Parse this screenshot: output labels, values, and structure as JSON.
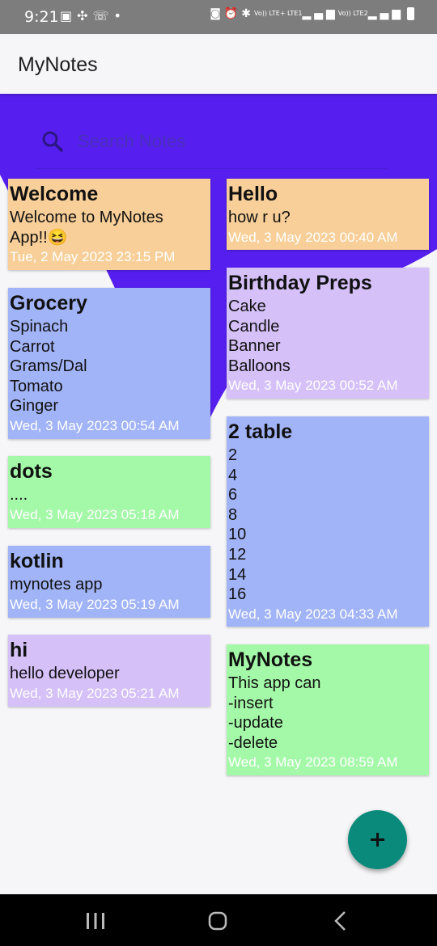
{
  "status_bar": {
    "time": "9:21",
    "left_icons": [
      "gallery-icon",
      "fan-icon",
      "missed-call-icon",
      "dot-icon"
    ],
    "right_icons": [
      "alarm-app-icon",
      "alarm-icon",
      "bluetooth-icon",
      "lte1-signal-icon",
      "lte2-signal-icon",
      "battery-icon"
    ],
    "lte1_label": "Vo)) LTE+\nLTE1",
    "lte2_label": "Vo))\nLTE2"
  },
  "app": {
    "title": "MyNotes"
  },
  "search": {
    "placeholder": "Search Notes",
    "value": ""
  },
  "colors": {
    "accent_purple": "#561ff0",
    "orange": "#f8cf98",
    "blue": "#a2b4f8",
    "green": "#a4f9a8",
    "lavender": "#d5c0f8",
    "fab": "#0a8a7a"
  },
  "notes": [
    {
      "title": "Welcome",
      "body": "Welcome to MyNotes\nApp!!😆",
      "date": "Tue, 2 May 2023 23:15 PM",
      "color": "#f8cf98"
    },
    {
      "title": "Hello",
      "body": "how r u?",
      "date": "Wed, 3 May 2023 00:40 AM",
      "color": "#f8cf98"
    },
    {
      "title": "Birthday Preps",
      "body": "Cake\nCandle\nBanner\nBalloons",
      "date": "Wed, 3 May 2023 00:52 AM",
      "color": "#d5c0f8"
    },
    {
      "title": "Grocery",
      "body": "Spinach\nCarrot\nGrams/Dal\nTomato\nGinger",
      "date": "Wed, 3 May 2023 00:54 AM",
      "color": "#a2b4f8"
    },
    {
      "title": "2 table",
      "body": "2\n4\n6\n8\n10\n12\n14\n16",
      "date": "Wed, 3 May 2023 04:33 AM",
      "color": "#a2b4f8"
    },
    {
      "title": "dots",
      "body": "....",
      "date": "Wed, 3 May 2023 05:18 AM",
      "color": "#a4f9a8"
    },
    {
      "title": "kotlin",
      "body": "mynotes app",
      "date": "Wed, 3 May 2023 05:19 AM",
      "color": "#a2b4f8"
    },
    {
      "title": "hi",
      "body": "hello developer",
      "date": "Wed, 3 May 2023 05:21 AM",
      "color": "#d5c0f8"
    },
    {
      "title": "MyNotes",
      "body": "This app can\n-insert\n-update\n-delete",
      "date": "Wed, 3 May 2023 08:59 AM",
      "color": "#a4f9a8"
    }
  ],
  "fab": {
    "icon": "plus-icon"
  },
  "nav_bar": {
    "icons": [
      "recents-icon",
      "home-icon",
      "back-icon"
    ]
  }
}
